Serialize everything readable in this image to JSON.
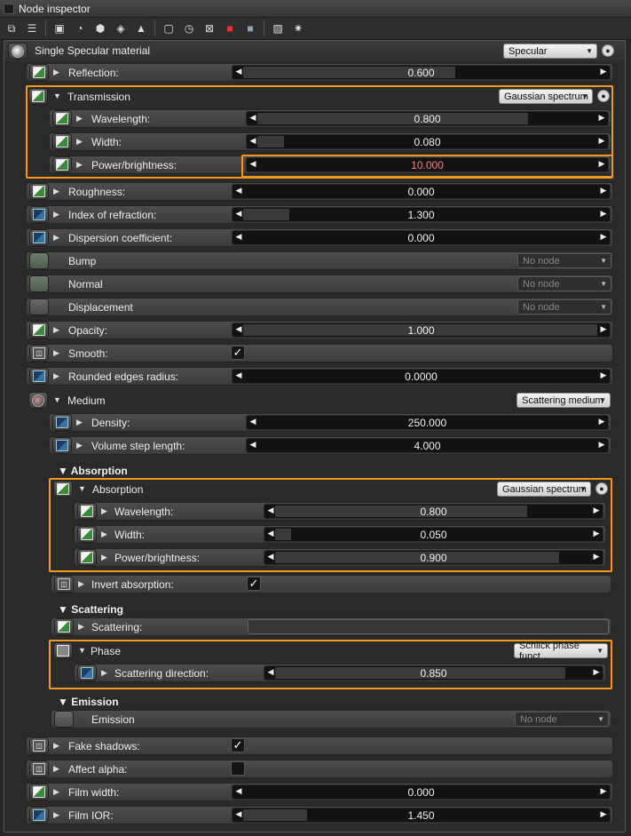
{
  "window": {
    "title": "Node inspector"
  },
  "toolbar": {
    "icons": [
      "copy-icon",
      "paste-icon",
      "image-icon",
      "render-icon",
      "geometry-icon",
      "layers-icon",
      "material-icon",
      "texture-icon",
      "clock-icon",
      "mesh-icon",
      "red-cube-icon",
      "blue-cube-icon",
      "picture-icon",
      "light-icon"
    ]
  },
  "material": {
    "name": "Single Specular material",
    "type": "Specular"
  },
  "reflection": {
    "label": "Reflection:",
    "value": "0.600"
  },
  "transmission": {
    "label": "Transmission",
    "type": "Gaussian spectrum",
    "wavelength": {
      "label": "Wavelength:",
      "value": "0.800"
    },
    "width": {
      "label": "Width:",
      "value": "0.080"
    },
    "power": {
      "label": "Power/brightness:",
      "value": "10.000"
    }
  },
  "roughness": {
    "label": "Roughness:",
    "value": "0.000"
  },
  "ior": {
    "label": "Index of refraction:",
    "value": "1.300"
  },
  "dispersion": {
    "label": "Dispersion coefficient:",
    "value": "0.000"
  },
  "bump": {
    "label": "Bump",
    "value": "No node"
  },
  "normal": {
    "label": "Normal",
    "value": "No node"
  },
  "displacement": {
    "label": "Displacement",
    "value": "No node"
  },
  "opacity": {
    "label": "Opacity:",
    "value": "1.000"
  },
  "smooth": {
    "label": "Smooth:",
    "checked": "✓"
  },
  "rounded": {
    "label": "Rounded edges radius:",
    "value": "0.0000"
  },
  "medium": {
    "label": "Medium",
    "type": "Scattering medium",
    "density": {
      "label": "Density:",
      "value": "250.000"
    },
    "step": {
      "label": "Volume step length:",
      "value": "4.000"
    }
  },
  "absorption_section": {
    "title": "▼ Absorption"
  },
  "absorption": {
    "label": "Absorption",
    "type": "Gaussian spectrum",
    "wavelength": {
      "label": "Wavelength:",
      "value": "0.800"
    },
    "width": {
      "label": "Width:",
      "value": "0.050"
    },
    "power": {
      "label": "Power/brightness:",
      "value": "0.900"
    }
  },
  "invert_absorption": {
    "label": "Invert absorption:",
    "checked": "✓"
  },
  "scattering_section": {
    "title": "Scattering"
  },
  "scattering": {
    "label": "Scattering:"
  },
  "phase": {
    "label": "Phase",
    "type": "Schlick phase funct…",
    "direction": {
      "label": "Scattering direction:",
      "value": "0.850"
    }
  },
  "emission_section": {
    "title": "▼ Emission"
  },
  "emission": {
    "label": "Emission",
    "value": "No node"
  },
  "fake_shadows": {
    "label": "Fake shadows:",
    "checked": "✓"
  },
  "affect_alpha": {
    "label": "Affect alpha:",
    "checked": ""
  },
  "film_width": {
    "label": "Film width:",
    "value": "0.000"
  },
  "film_ior": {
    "label": "Film IOR:",
    "value": "1.450"
  },
  "fills": {
    "reflection": 0.6,
    "trans_wavelength": 0.8,
    "trans_width": 0.08,
    "trans_power": 0.0,
    "roughness": 0.0,
    "ior": 0.13,
    "dispersion": 0.0,
    "opacity": 1.0,
    "rounded": 0.0,
    "density": 0.0,
    "step": 0.0,
    "abs_wavelength": 0.8,
    "abs_width": 0.05,
    "abs_power": 0.9,
    "direction": 0.92,
    "film_width": 0.0,
    "film_ior": 0.18
  },
  "colors": {
    "highlight": "#f39a1e",
    "panel": "#262626",
    "red_value": "#ff7a8a"
  }
}
